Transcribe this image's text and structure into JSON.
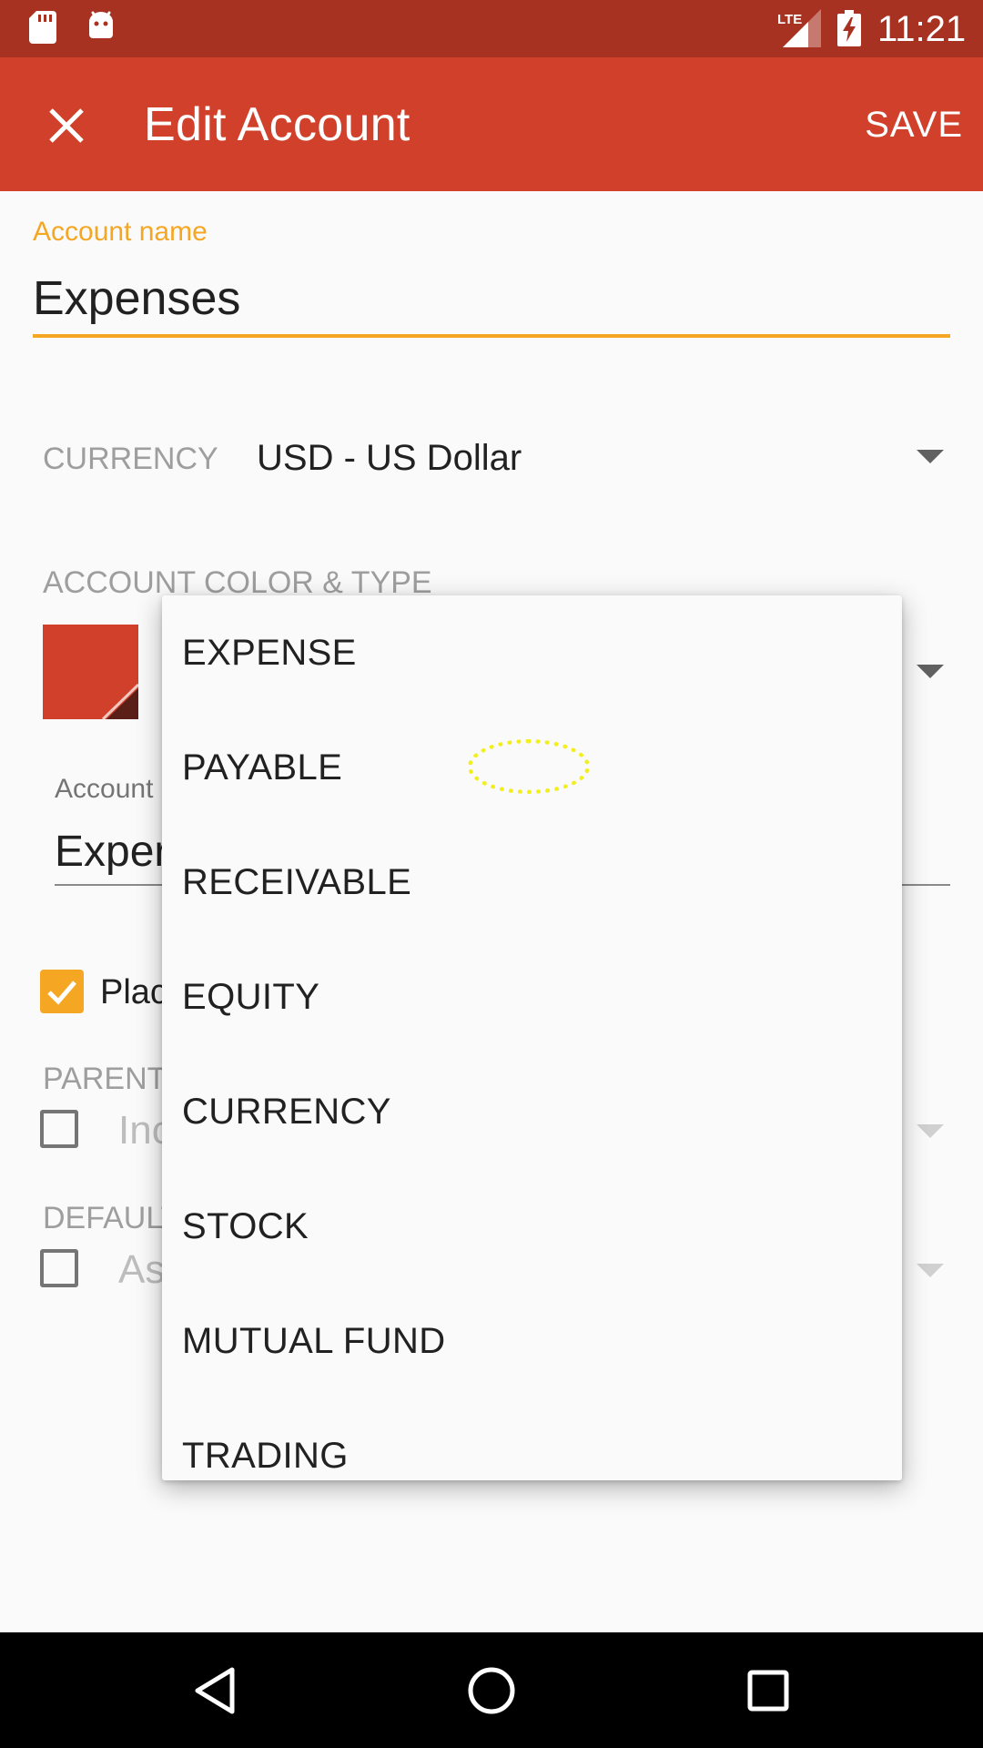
{
  "status_bar": {
    "time": "11:21",
    "network": "LTE"
  },
  "app_bar": {
    "title": "Edit Account",
    "save_label": "SAVE"
  },
  "account_name": {
    "label": "Account name",
    "value": "Expenses"
  },
  "currency": {
    "label": "CURRENCY",
    "value": "USD - US Dollar"
  },
  "color_type": {
    "label": "ACCOUNT COLOR & TYPE",
    "swatch_color": "#d1402b"
  },
  "account_code": {
    "label_visible": "Account",
    "value_visible": "Exper"
  },
  "placeholder": {
    "label_visible": "Plac",
    "checked": true
  },
  "parent_account": {
    "label_visible": "PARENT",
    "value_visible": "Inc",
    "checked": false
  },
  "default_transfer": {
    "label_visible": "DEFAULT",
    "value_visible": "As",
    "checked": false
  },
  "type_dropdown": {
    "options": [
      "EXPENSE",
      "PAYABLE",
      "RECEIVABLE",
      "EQUITY",
      "CURRENCY",
      "STOCK",
      "MUTUAL FUND",
      "TRADING"
    ]
  },
  "colors": {
    "status_bar": "#a83222",
    "app_bar": "#d1402b",
    "accent": "#f5a623"
  },
  "icons": [
    "sd-card-icon",
    "android-icon",
    "lte-signal-icon",
    "battery-charging-icon",
    "close-icon",
    "dropdown-arrow-icon",
    "checkbox-checked-icon",
    "back-icon",
    "home-icon",
    "recents-icon"
  ]
}
